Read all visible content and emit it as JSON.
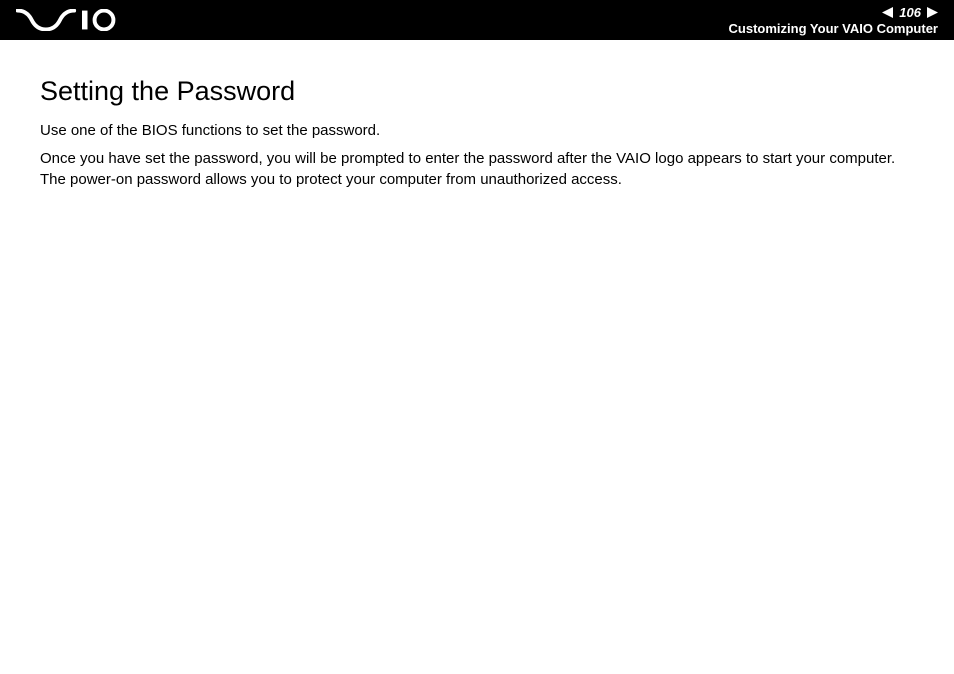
{
  "header": {
    "page_number": "106",
    "breadcrumb": "Customizing Your VAIO Computer"
  },
  "content": {
    "title": "Setting the Password",
    "paragraph1": "Use one of the BIOS functions to set the password.",
    "paragraph2": "Once you have set the password, you will be prompted to enter the password after the VAIO logo appears to start your computer. The power-on password allows you to protect your computer from unauthorized access."
  }
}
